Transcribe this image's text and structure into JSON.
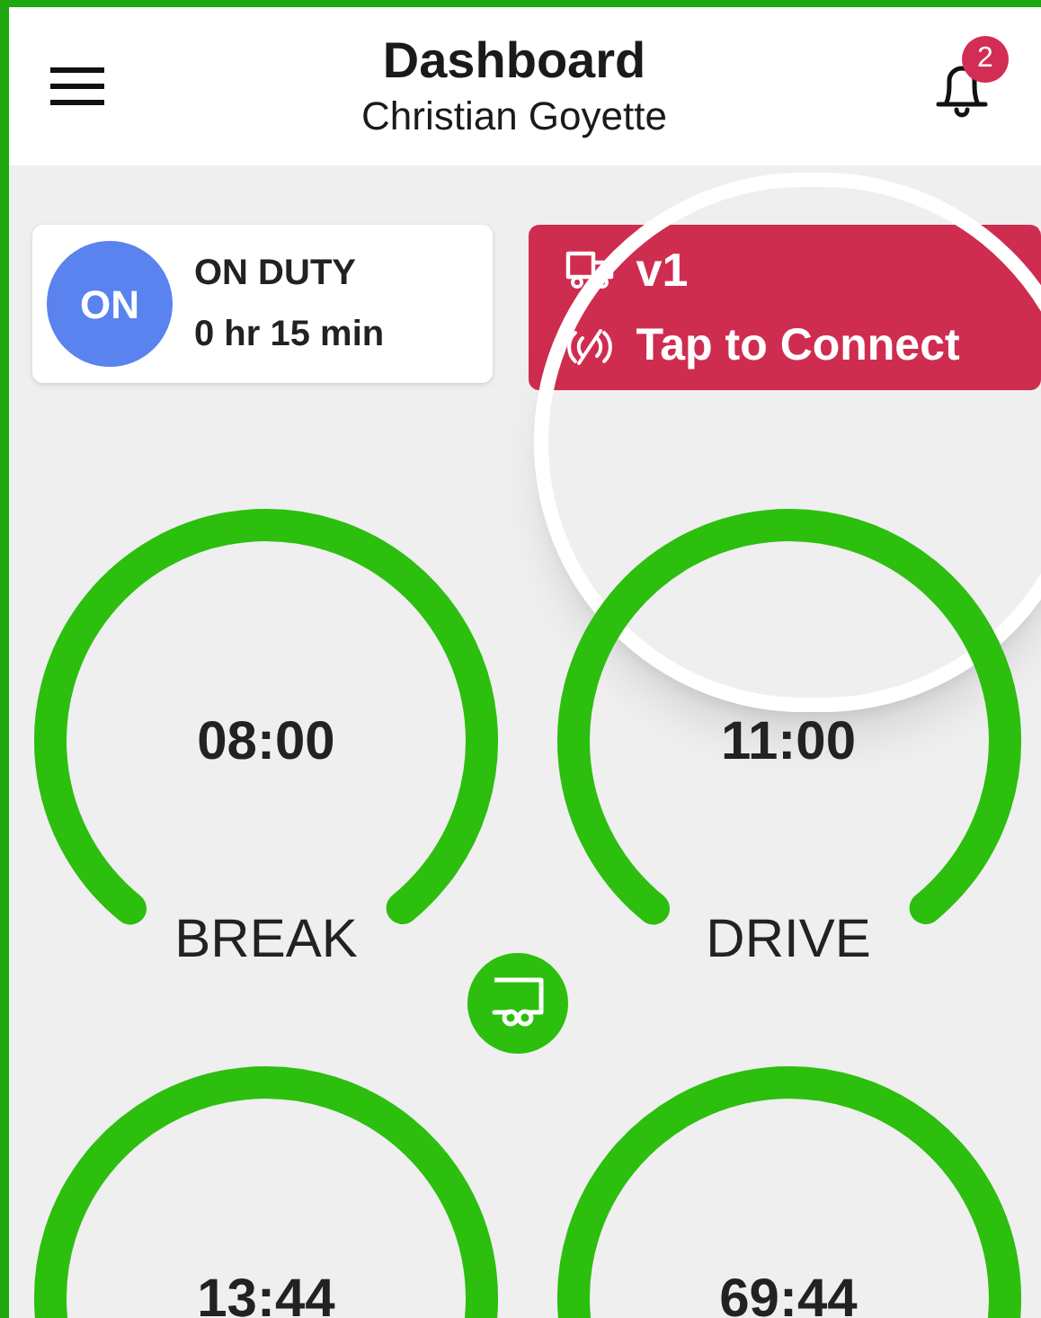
{
  "header": {
    "title": "Dashboard",
    "subtitle": "Christian Goyette",
    "notification_count": "2"
  },
  "status_card": {
    "badge": "ON",
    "status": "ON DUTY",
    "duration": "0 hr 15 min"
  },
  "vehicle_card": {
    "vehicle": "v1",
    "action": "Tap to Connect",
    "connected": false
  },
  "gauges": [
    {
      "time": "08:00",
      "label": "BREAK",
      "level": 1
    },
    {
      "time": "11:00",
      "label": "DRIVE",
      "level": 1
    },
    {
      "time": "13:44",
      "level": 1
    },
    {
      "time": "69:44",
      "level": 1
    }
  ]
}
